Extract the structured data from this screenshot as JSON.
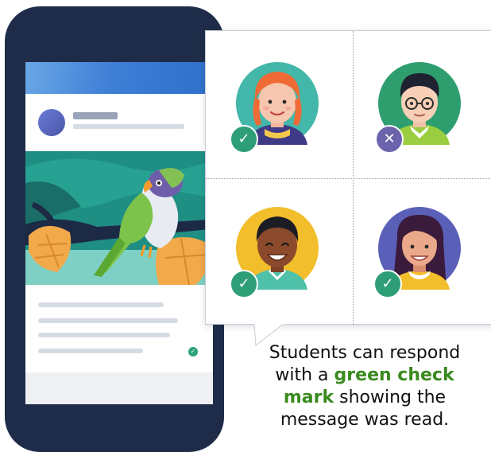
{
  "caption": {
    "line1": "Students can respond",
    "line2_prefix": "with a ",
    "line2_emphasis": "green check",
    "line3_emphasis": "mark",
    "line3_suffix": " showing the",
    "line4": "message was read."
  },
  "colors": {
    "phone_frame": "#1f2c49",
    "header_blue": "#3f7fd6",
    "check_green": "#2e9e77",
    "cross_purple": "#6b64ad",
    "caption_emphasis": "#3a8a1f"
  },
  "responses": [
    {
      "student": "red-haired-girl",
      "status": "read",
      "badge_icon": "check-icon",
      "badge_glyph": "✓"
    },
    {
      "student": "boy-with-glasses",
      "status": "not-read",
      "badge_icon": "cross-icon",
      "badge_glyph": "✕"
    },
    {
      "student": "smiling-boy",
      "status": "read",
      "badge_icon": "check-icon",
      "badge_glyph": "✓"
    },
    {
      "student": "girl-with-long-hair",
      "status": "read",
      "badge_icon": "check-icon",
      "badge_glyph": "✓"
    }
  ],
  "post_status_icon": "check-icon"
}
